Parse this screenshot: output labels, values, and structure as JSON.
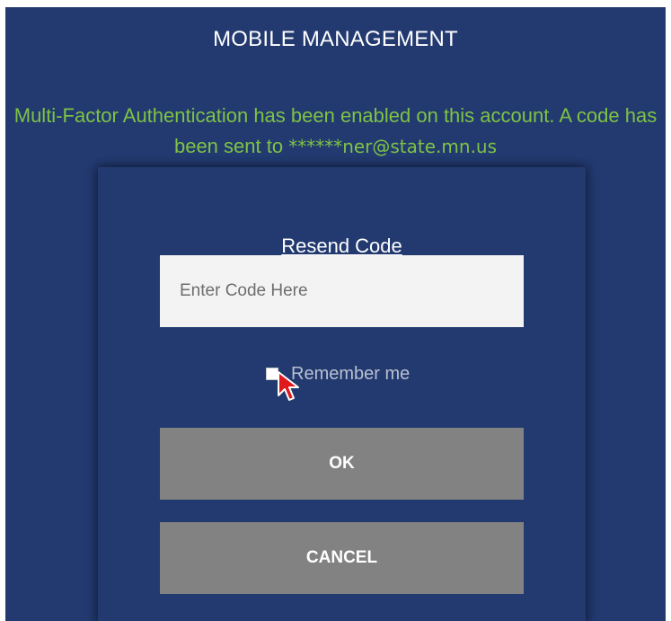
{
  "header": {
    "title": "MOBILE MANAGEMENT"
  },
  "mfa": {
    "message": "Multi-Factor Authentication has been enabled on this account. A code has been sent to ",
    "email": "******ner@state.mn.us"
  },
  "form": {
    "resend_label": "Resend Code",
    "code_placeholder": "Enter Code Here",
    "code_value": "",
    "remember_label": "Remember me",
    "remember_checked": false,
    "ok_label": "OK",
    "cancel_label": "CANCEL"
  },
  "colors": {
    "background": "#233a70",
    "message_text": "#7ec345",
    "input_bg": "#f3f3f3",
    "button_bg": "#828282",
    "cursor": "#e0191c"
  }
}
